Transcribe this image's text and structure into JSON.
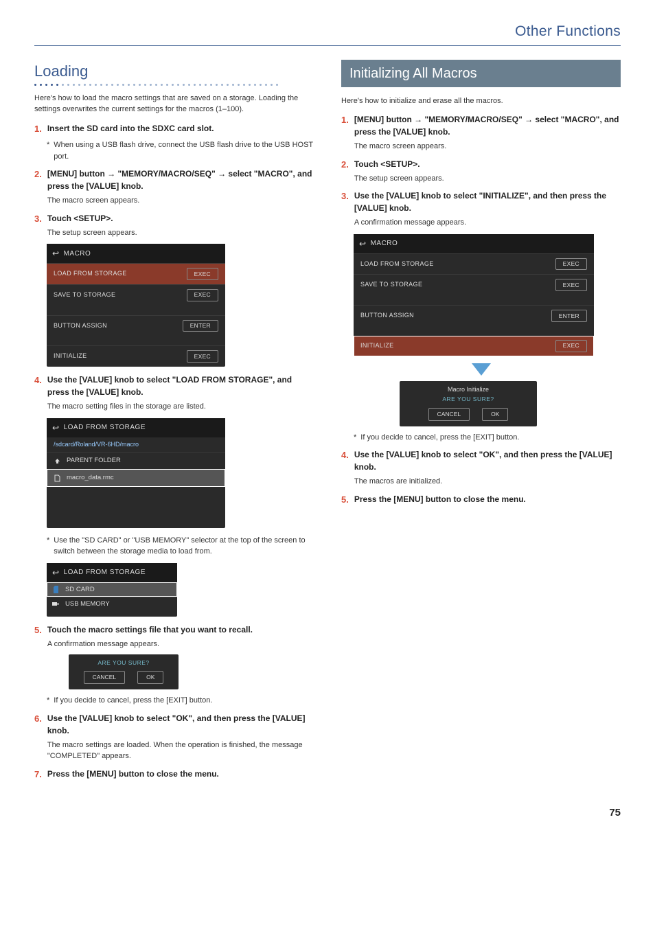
{
  "header": {
    "section": "Other Functions"
  },
  "page_number": "75",
  "left": {
    "heading": "Loading",
    "intro": "Here's how to load the macro settings that are saved on a storage. Loading the settings overwrites the current settings for the macros (1–100).",
    "steps": [
      {
        "n": "1.",
        "main": "Insert the SD card into the SDXC card slot.",
        "note": "When using a USB flash drive, connect the USB flash drive to the USB HOST port."
      },
      {
        "n": "2.",
        "main": "[MENU] button → \"MEMORY/MACRO/SEQ\" → select \"MACRO\", and press the [VALUE] knob.",
        "sub": "The macro screen appears."
      },
      {
        "n": "3.",
        "main": "Touch <SETUP>.",
        "sub": "The setup screen appears."
      },
      {
        "n": "4.",
        "main": "Use the [VALUE] knob to select \"LOAD FROM STORAGE\", and press the [VALUE] knob.",
        "sub": "The macro setting files in the storage are listed."
      },
      {
        "n": "5.",
        "main": "Touch the macro settings file that you want to recall.",
        "sub": "A confirmation message appears."
      },
      {
        "n": "6.",
        "main": "Use the [VALUE] knob to select \"OK\", and then press the [VALUE] knob.",
        "sub": "The macro settings are loaded. When the operation is finished, the message \"COMPLETED\" appears."
      },
      {
        "n": "7.",
        "main": "Press the [MENU] button to close the menu."
      }
    ],
    "note_after_4b": "Use the \"SD CARD\" or \"USB MEMORY\" selector at the top of the screen to switch between the storage media to load from.",
    "note_after_5b": "If you decide to cancel, press the [EXIT] button.",
    "ui_macro": {
      "title": "MACRO",
      "rows": [
        {
          "label": "LOAD FROM STORAGE",
          "btn": "EXEC",
          "hi": true
        },
        {
          "label": "SAVE TO STORAGE",
          "btn": "EXEC"
        },
        {
          "label": "BUTTON ASSIGN",
          "btn": "ENTER"
        },
        {
          "label": "INITIALIZE",
          "btn": "EXEC"
        }
      ]
    },
    "ui_load": {
      "title": "LOAD FROM STORAGE",
      "path": "/sdcard/Roland/VR-6HD/macro",
      "items": [
        {
          "icon": "up",
          "label": "PARENT FOLDER"
        },
        {
          "icon": "file",
          "label": "macro_data.rmc",
          "sel": true
        }
      ]
    },
    "ui_selector": {
      "title": "LOAD FROM STORAGE",
      "items": [
        {
          "icon": "sd",
          "label": "SD CARD",
          "sel": true
        },
        {
          "icon": "usb",
          "label": "USB MEMORY"
        }
      ]
    },
    "ui_confirm": {
      "title": "ARE YOU SURE?",
      "cancel": "CANCEL",
      "ok": "OK"
    }
  },
  "right": {
    "heading": "Initializing All Macros",
    "intro": "Here's how to initialize and erase all the macros.",
    "steps": [
      {
        "n": "1.",
        "main": "[MENU] button → \"MEMORY/MACRO/SEQ\" → select \"MACRO\", and press the [VALUE] knob.",
        "sub": "The macro screen appears."
      },
      {
        "n": "2.",
        "main": "Touch <SETUP>.",
        "sub": "The setup screen appears."
      },
      {
        "n": "3.",
        "main": "Use the [VALUE] knob to select \"INITIALIZE\", and then press the [VALUE] knob.",
        "sub": "A confirmation message appears."
      },
      {
        "n": "4.",
        "main": "Use the [VALUE] knob to select \"OK\", and then press the [VALUE] knob.",
        "sub": "The macros are initialized."
      },
      {
        "n": "5.",
        "main": "Press the [MENU] button to close the menu."
      }
    ],
    "note_after_3b": "If you decide to cancel, press the [EXIT] button.",
    "ui_macro": {
      "title": "MACRO",
      "rows": [
        {
          "label": "LOAD FROM STORAGE",
          "btn": "EXEC"
        },
        {
          "label": "SAVE TO STORAGE",
          "btn": "EXEC"
        },
        {
          "label": "BUTTON ASSIGN",
          "btn": "ENTER"
        },
        {
          "label": "INITIALIZE",
          "btn": "EXEC",
          "hi": true
        }
      ]
    },
    "ui_confirm": {
      "title2": "Macro Initialize",
      "title": "ARE YOU SURE?",
      "cancel": "CANCEL",
      "ok": "OK"
    }
  }
}
